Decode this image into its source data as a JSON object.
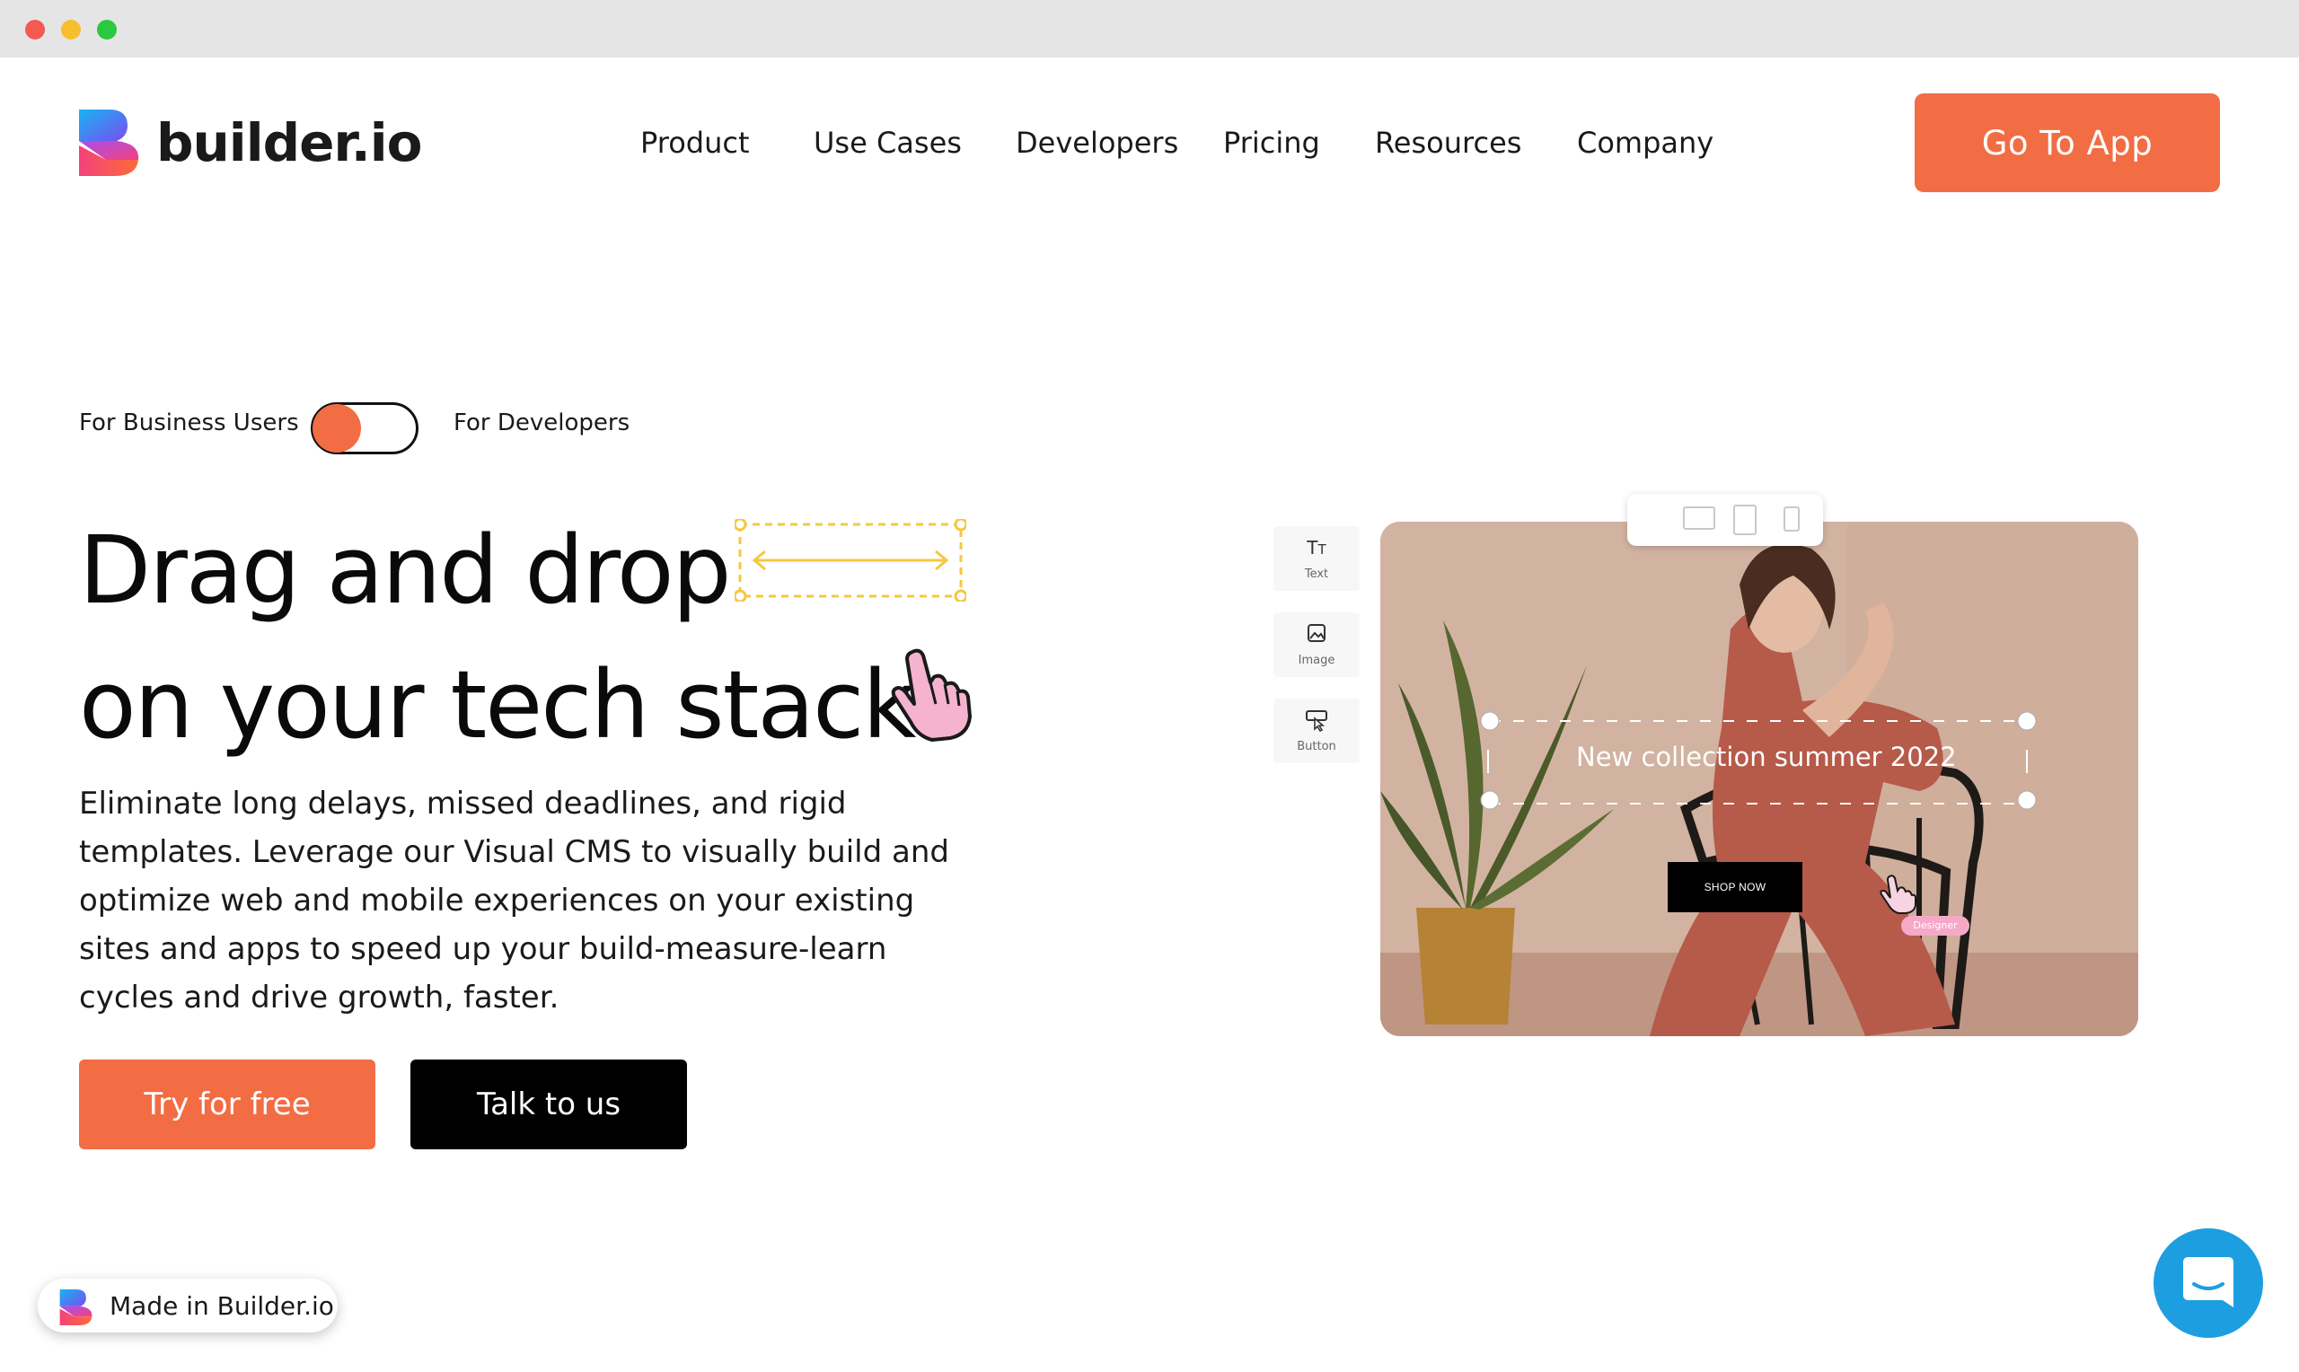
{
  "brand": {
    "name": "builder.io",
    "accent": "#f26c44",
    "dark": "#000000"
  },
  "nav": {
    "items": [
      "Product",
      "Use Cases",
      "Developers",
      "Pricing",
      "Resources",
      "Company"
    ],
    "cta": "Go To App"
  },
  "hero": {
    "toggle_left": "For Business Users",
    "toggle_right": "For Developers",
    "headline_line1": "Drag and drop",
    "headline_line2": "on your tech stack",
    "description": "Eliminate long delays, missed deadlines, and rigid templates. Leverage our Visual CMS to visually build and optimize web and mobile experiences on your existing sites and apps to speed up your build-measure-learn cycles and drive growth, faster.",
    "primary_button": "Try for free",
    "secondary_button": "Talk to us"
  },
  "editor": {
    "tools": [
      {
        "label": "Text",
        "icon": "text-icon"
      },
      {
        "label": "Image",
        "icon": "image-icon"
      },
      {
        "label": "Button",
        "icon": "button-icon"
      }
    ],
    "devices": [
      "desktop-icon",
      "tablet-icon",
      "mobile-icon"
    ],
    "banner_text": "New collection summer 2022",
    "shop_button": "SHOP NOW",
    "cursor_tag": "Designer"
  },
  "footer": {
    "made_in": "Made in Builder.io"
  },
  "icons": {
    "chat": "chat-icon"
  }
}
